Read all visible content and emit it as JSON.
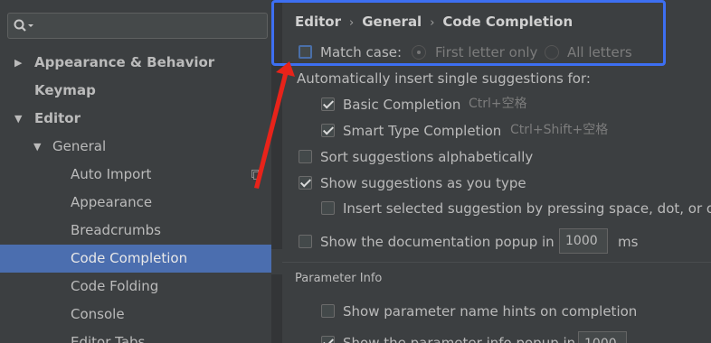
{
  "sidebar": {
    "search_value": "",
    "items": [
      {
        "label": "Appearance & Behavior",
        "level": 0,
        "bold": true,
        "arrow": "▶"
      },
      {
        "label": "Keymap",
        "level": 0,
        "bold": true,
        "arrow": ""
      },
      {
        "label": "Editor",
        "level": 0,
        "bold": true,
        "arrow": "▼"
      },
      {
        "label": "General",
        "level": 1,
        "bold": false,
        "arrow": "▼"
      },
      {
        "label": "Auto Import",
        "level": 2,
        "bold": false,
        "arrow": ""
      },
      {
        "label": "Appearance",
        "level": 2,
        "bold": false,
        "arrow": ""
      },
      {
        "label": "Breadcrumbs",
        "level": 2,
        "bold": false,
        "arrow": ""
      },
      {
        "label": "Code Completion",
        "level": 2,
        "bold": false,
        "arrow": "",
        "selected": true
      },
      {
        "label": "Code Folding",
        "level": 2,
        "bold": false,
        "arrow": ""
      },
      {
        "label": "Console",
        "level": 2,
        "bold": false,
        "arrow": ""
      },
      {
        "label": "Editor Tabs",
        "level": 2,
        "bold": false,
        "arrow": ""
      }
    ]
  },
  "breadcrumb": [
    "Editor",
    "General",
    "Code Completion"
  ],
  "match_case": {
    "label": "Match case:",
    "checked": false,
    "options": [
      "First letter only",
      "All letters"
    ],
    "selected": "First letter only"
  },
  "auto_insert": {
    "heading": "Automatically insert single suggestions for:",
    "basic": {
      "label": "Basic Completion",
      "shortcut": "Ctrl+空格",
      "checked": true
    },
    "smart": {
      "label": "Smart Type Completion",
      "shortcut": "Ctrl+Shift+空格",
      "checked": true
    }
  },
  "options": {
    "sort_alpha": {
      "label": "Sort suggestions alphabetically",
      "checked": false
    },
    "show_as_type": {
      "label": "Show suggestions as you type",
      "checked": true
    },
    "insert_selected": {
      "label": "Insert selected suggestion by pressing space, dot, or other context-dependent keys",
      "checked": false
    },
    "doc_popup": {
      "label": "Show the documentation popup in",
      "value": "1000",
      "unit": "ms",
      "checked": false
    }
  },
  "parameter_info": {
    "title": "Parameter Info",
    "name_hints": {
      "label": "Show parameter name hints on completion",
      "checked": false
    },
    "show_info": {
      "label": "Show the parameter info popup in",
      "value": "1000",
      "checked": true
    }
  },
  "colors": {
    "selection": "#4b6eaf",
    "highlight": "#3d6ff2",
    "arrow": "#e8231a"
  }
}
